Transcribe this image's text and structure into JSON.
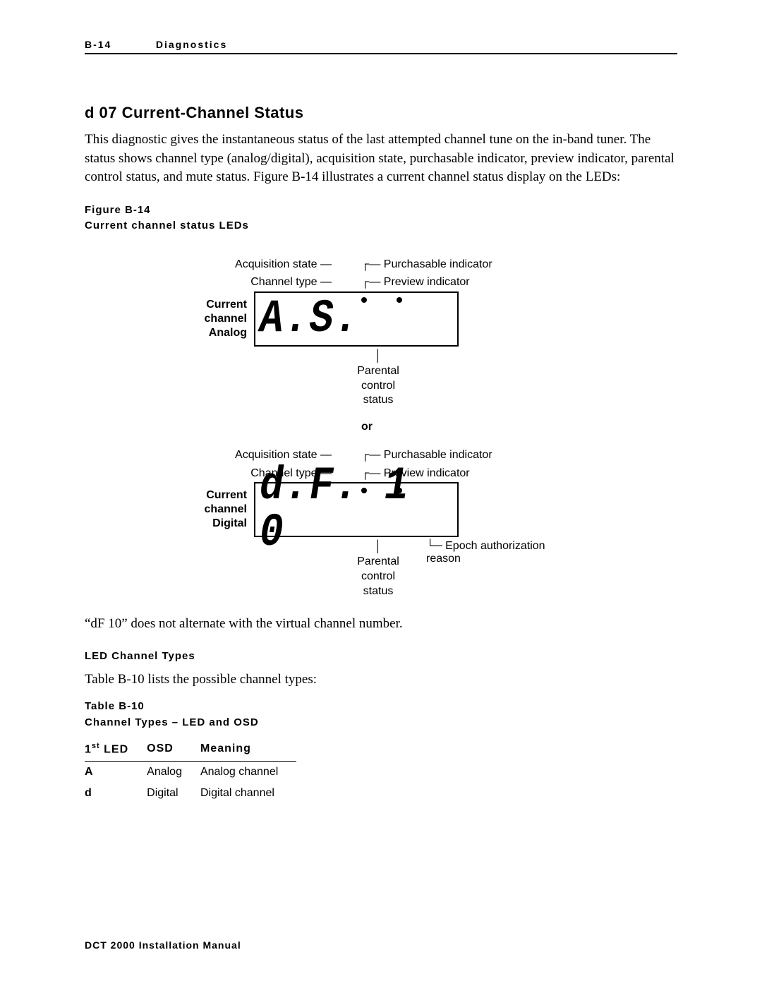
{
  "header": {
    "page": "B-14",
    "section": "Diagnostics"
  },
  "title": "d 07 Current-Channel Status",
  "intro": "This diagnostic gives the instantaneous status of the last attempted channel tune on the in-band tuner. The status shows channel type (analog/digital), acquisition state, purchasable indicator, preview indicator, parental control status, and mute status. Figure B-14 illustrates a current channel status display on the LEDs:",
  "figure": {
    "number": "Figure B-14",
    "caption": "Current channel status LEDs",
    "callout_acq": "Acquisition state",
    "callout_type": "Channel type",
    "callout_purch": "Purchasable indicator",
    "callout_prev": "Preview indicator",
    "callout_parental_l1": "Parental",
    "callout_parental_l2": "control",
    "callout_parental_l3": "status",
    "callout_epoch": "Epoch authorization reason",
    "side_a_l1": "Current",
    "side_a_l2": "channel",
    "side_a_l3": "Analog",
    "side_d_l1": "Current",
    "side_d_l2": "channel",
    "side_d_l3": "Digital",
    "display_a": "A.S.",
    "display_d": "d.F. 1 0",
    "or": "or"
  },
  "note": "“dF 10” does not alternate with the virtual channel number.",
  "subhead": "LED Channel Types",
  "subhead_intro": "Table B-10 lists the possible channel types:",
  "table": {
    "number": "Table B-10",
    "caption": "Channel Types – LED and OSD",
    "col1_a": "1",
    "col1_b": "st",
    "col1_c": " LED",
    "col2": "OSD",
    "col3": "Meaning",
    "rows": [
      {
        "led": "A",
        "osd": "Analog",
        "meaning": "Analog channel"
      },
      {
        "led": "d",
        "osd": "Digital",
        "meaning": "Digital channel"
      }
    ]
  },
  "footer": "DCT 2000 Installation Manual"
}
